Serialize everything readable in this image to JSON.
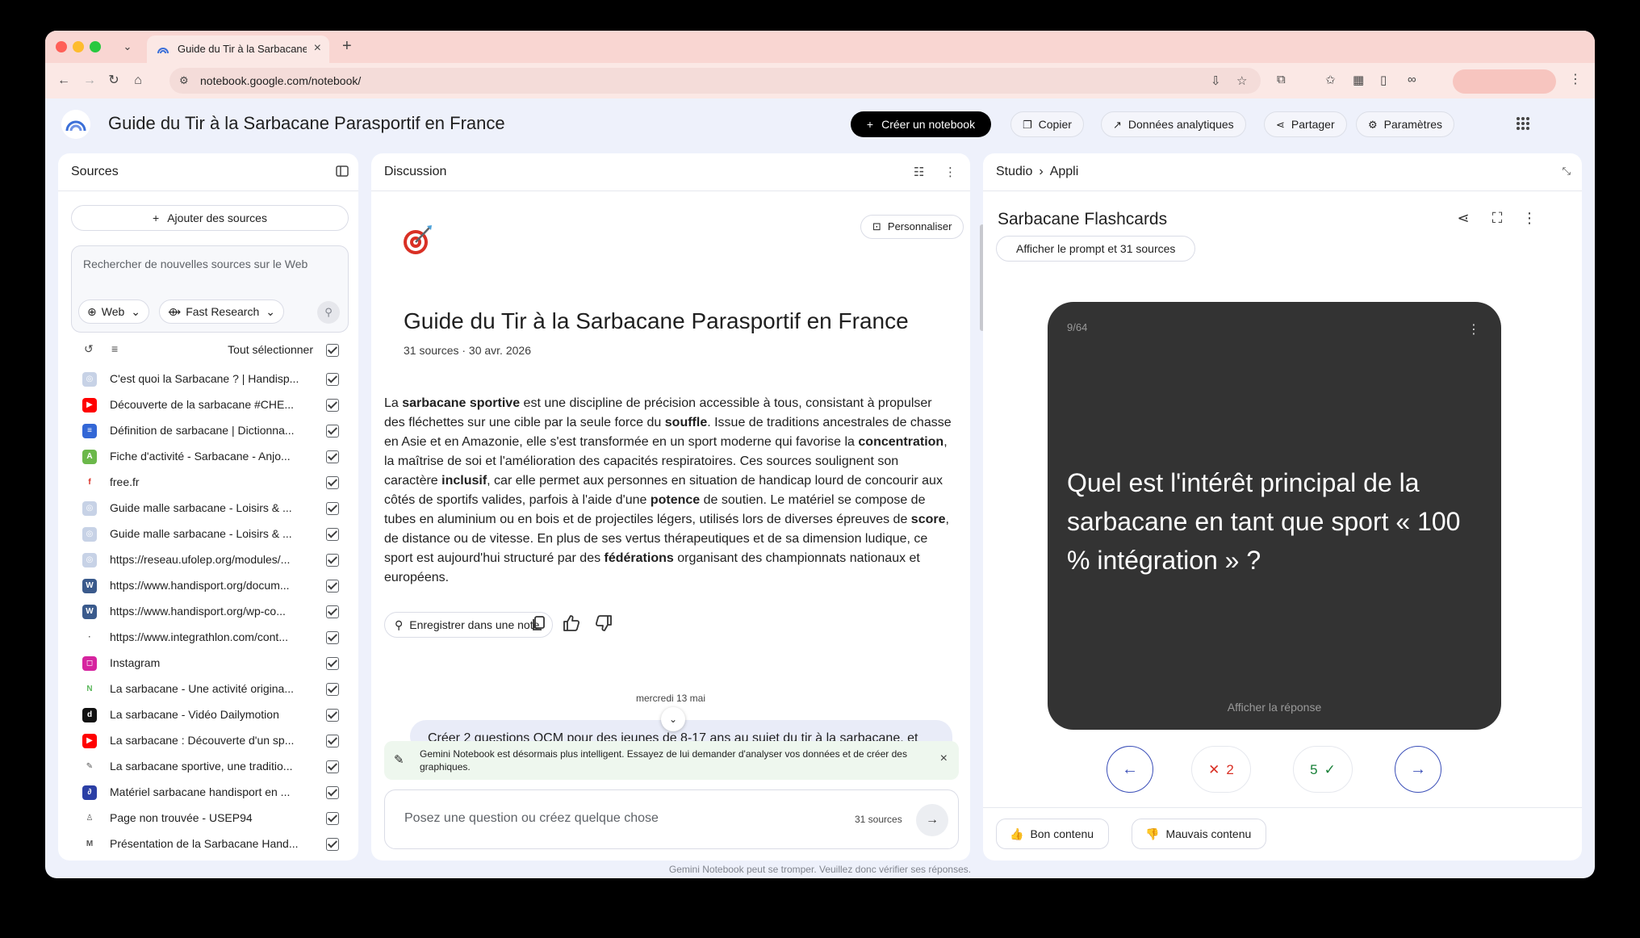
{
  "browser": {
    "tab_title": "Guide du Tir à la Sarbacane P",
    "url": "notebook.google.com/notebook/"
  },
  "header": {
    "title": "Guide du Tir à la Sarbacane Parasportif en France",
    "create_label": "Créer un notebook",
    "copy_label": "Copier",
    "analytics_label": "Données analytiques",
    "share_label": "Partager",
    "settings_label": "Paramètres"
  },
  "sources": {
    "title": "Sources",
    "add_label": "Ajouter des sources",
    "search_placeholder": "Rechercher de nouvelles sources sur le Web",
    "chip_web": "Web",
    "chip_research": "Fast Research",
    "select_all": "Tout sélectionner",
    "items": [
      {
        "name": "C'est quoi la Sarbacane ? | Handisp...",
        "icon": "globe-icon"
      },
      {
        "name": "Découverte de la sarbacane #CHE...",
        "icon": "youtube-icon"
      },
      {
        "name": "Définition de sarbacane | Dictionna...",
        "icon": "dictionary-icon"
      },
      {
        "name": "Fiche d'activité - Sarbacane - Anjo...",
        "icon": "asso-icon"
      },
      {
        "name": "free.fr",
        "icon": "free-icon"
      },
      {
        "name": "Guide malle sarbacane - Loisirs & ...",
        "icon": "globe-icon"
      },
      {
        "name": "Guide malle sarbacane - Loisirs & ...",
        "icon": "globe-icon"
      },
      {
        "name": "https://reseau.ufolep.org/modules/...",
        "icon": "globe-icon"
      },
      {
        "name": "https://www.handisport.org/docum...",
        "icon": "wordpress-icon"
      },
      {
        "name": "https://www.handisport.org/wp-co...",
        "icon": "wordpress-icon"
      },
      {
        "name": "https://www.integrathlon.com/cont...",
        "icon": "blank-icon"
      },
      {
        "name": "Instagram",
        "icon": "instagram-icon"
      },
      {
        "name": "La sarbacane - Une activité origina...",
        "icon": "n-icon"
      },
      {
        "name": "La sarbacane - Vidéo Dailymotion",
        "icon": "dailymotion-icon"
      },
      {
        "name": "La sarbacane : Découverte d'un sp...",
        "icon": "youtube-icon"
      },
      {
        "name": "La sarbacane sportive, une traditio...",
        "icon": "feather-icon"
      },
      {
        "name": "Matériel sarbacane handisport en ...",
        "icon": "brand-icon"
      },
      {
        "name": "Page non trouvée - USEP94",
        "icon": "usep-icon"
      },
      {
        "name": "Présentation de la Sarbacane Hand...",
        "icon": "mj-icon"
      }
    ]
  },
  "discussion": {
    "title": "Discussion",
    "personalize_label": "Personnaliser",
    "notebook_title": "Guide du Tir à la Sarbacane Parasportif en France",
    "meta": "31 sources · 30 avr. 2026",
    "summary": {
      "p1": "La ",
      "b1": "sarbacane sportive",
      "p2": " est une discipline de précision accessible à tous, consistant à propulser des fléchettes sur une cible par la seule force du ",
      "b2": "souffle",
      "p3": ". Issue de traditions ancestrales de chasse en Asie et en Amazonie, elle s'est transformée en un sport moderne qui favorise la ",
      "b3": "concentration",
      "p4": ", la maîtrise de soi et l'amélioration des capacités respiratoires. Ces sources soulignent son caractère ",
      "b4": "inclusif",
      "p5": ", car elle permet aux personnes en situation de handicap lourd de concourir aux côtés de sportifs valides, parfois à l'aide d'une ",
      "b5": "potence",
      "p6": " de soutien. Le matériel se compose de tubes en aluminium ou en bois et de projectiles légers, utilisés lors de diverses épreuves de ",
      "b6": "score",
      "p7": ", de distance ou de vitesse. En plus de ses vertus thérapeutiques et de sa dimension ludique, ce sport est aujourd'hui structuré par des ",
      "b7": "fédérations",
      "p8": " organisant des championnats nationaux et européens."
    },
    "save_note_label": "Enregistrer dans une note",
    "date_separator": "mercredi 13 mai",
    "user_message": "Créer 2 questions QCM pour des jeunes de 8-17 ans au sujet du tir à la sarbacane, et",
    "banner_text": "Gemini Notebook est désormais plus intelligent. Essayez de lui demander d'analyser vos données et de créer des graphiques.",
    "ask_placeholder": "Posez une question ou créez quelque chose",
    "ask_count": "31 sources"
  },
  "studio": {
    "crumb_root": "Studio",
    "crumb_current": "Appli",
    "title": "Sarbacane Flashcards",
    "prompt_label": "Afficher le prompt et 31 sources",
    "card_counter": "9/64",
    "question": "Quel est l'intérêt principal de la sarbacane en tant que sport « 100 % intégration » ?",
    "show_answer": "Afficher la réponse",
    "wrong_count": "2",
    "right_count": "5",
    "good_label": "Bon contenu",
    "bad_label": "Mauvais contenu"
  },
  "footer": {
    "note": "Gemini Notebook peut se tromper. Veuillez donc vérifier ses réponses."
  }
}
